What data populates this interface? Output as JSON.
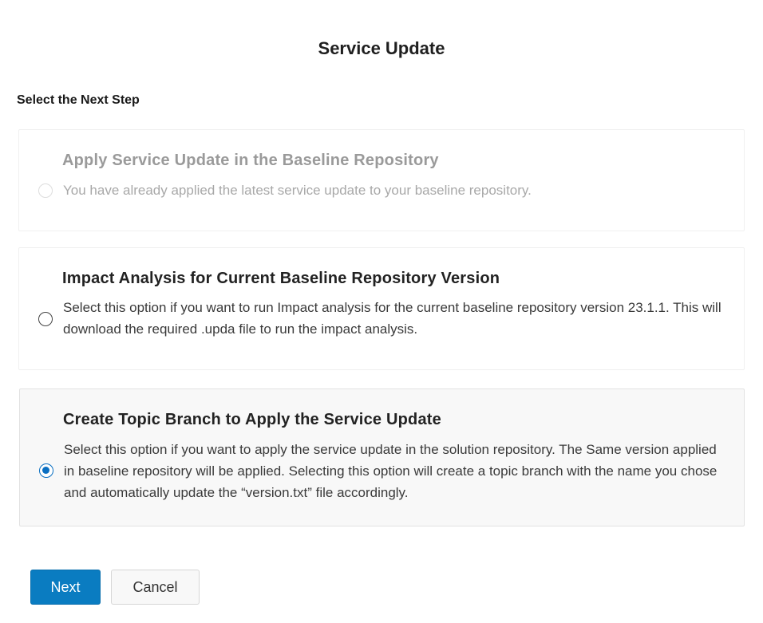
{
  "dialog": {
    "title": "Service Update",
    "section_label": "Select the Next Step"
  },
  "options": [
    {
      "title": "Apply Service Update in the Baseline Repository",
      "description": "You have already applied the latest service update to your baseline repository.",
      "state": "disabled"
    },
    {
      "title": "Impact Analysis for Current Baseline Repository Version",
      "description": "Select this option if you want to run Impact analysis for the current baseline repository version 23.1.1. This will download the required .upda file to run the impact analysis.",
      "state": "unselected"
    },
    {
      "title": "Create Topic Branch to Apply the Service Update",
      "description": "Select this option if you want to apply the service update in the solution repository. The Same version applied in baseline repository will be applied. Selecting this option will create a topic branch with the name you chose and automatically update the “version.txt” file accordingly.",
      "state": "selected"
    }
  ],
  "footer": {
    "next_label": "Next",
    "cancel_label": "Cancel"
  },
  "colors": {
    "accent": "#0a7cc1",
    "radio_selected": "#0a6fc2",
    "disabled_text": "#9a9a9a"
  }
}
